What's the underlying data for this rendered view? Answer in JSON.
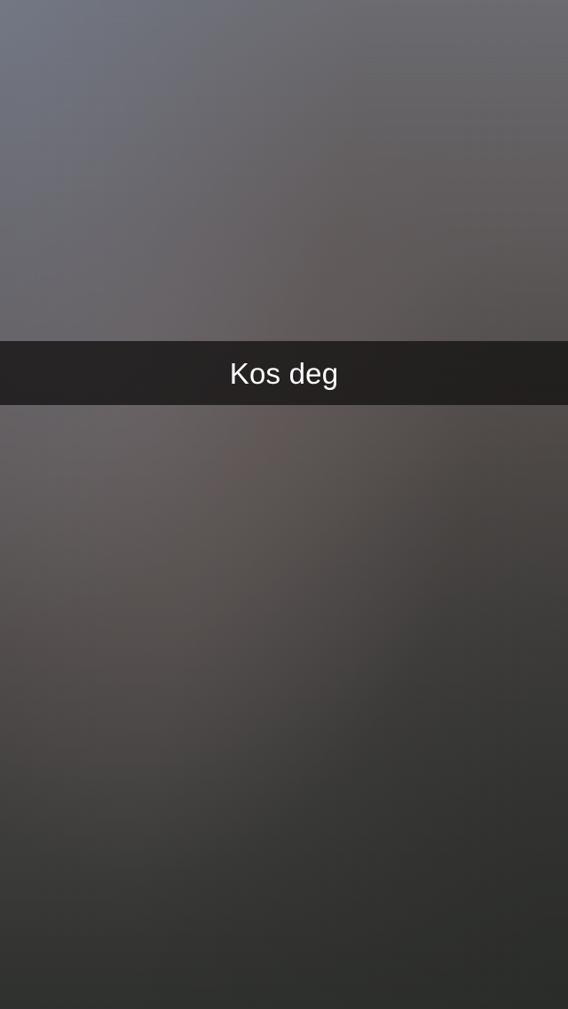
{
  "snap": {
    "caption": "Kos deg"
  },
  "colors": {
    "caption_bar_bg": "#141212",
    "caption_text": "#ffffff"
  }
}
